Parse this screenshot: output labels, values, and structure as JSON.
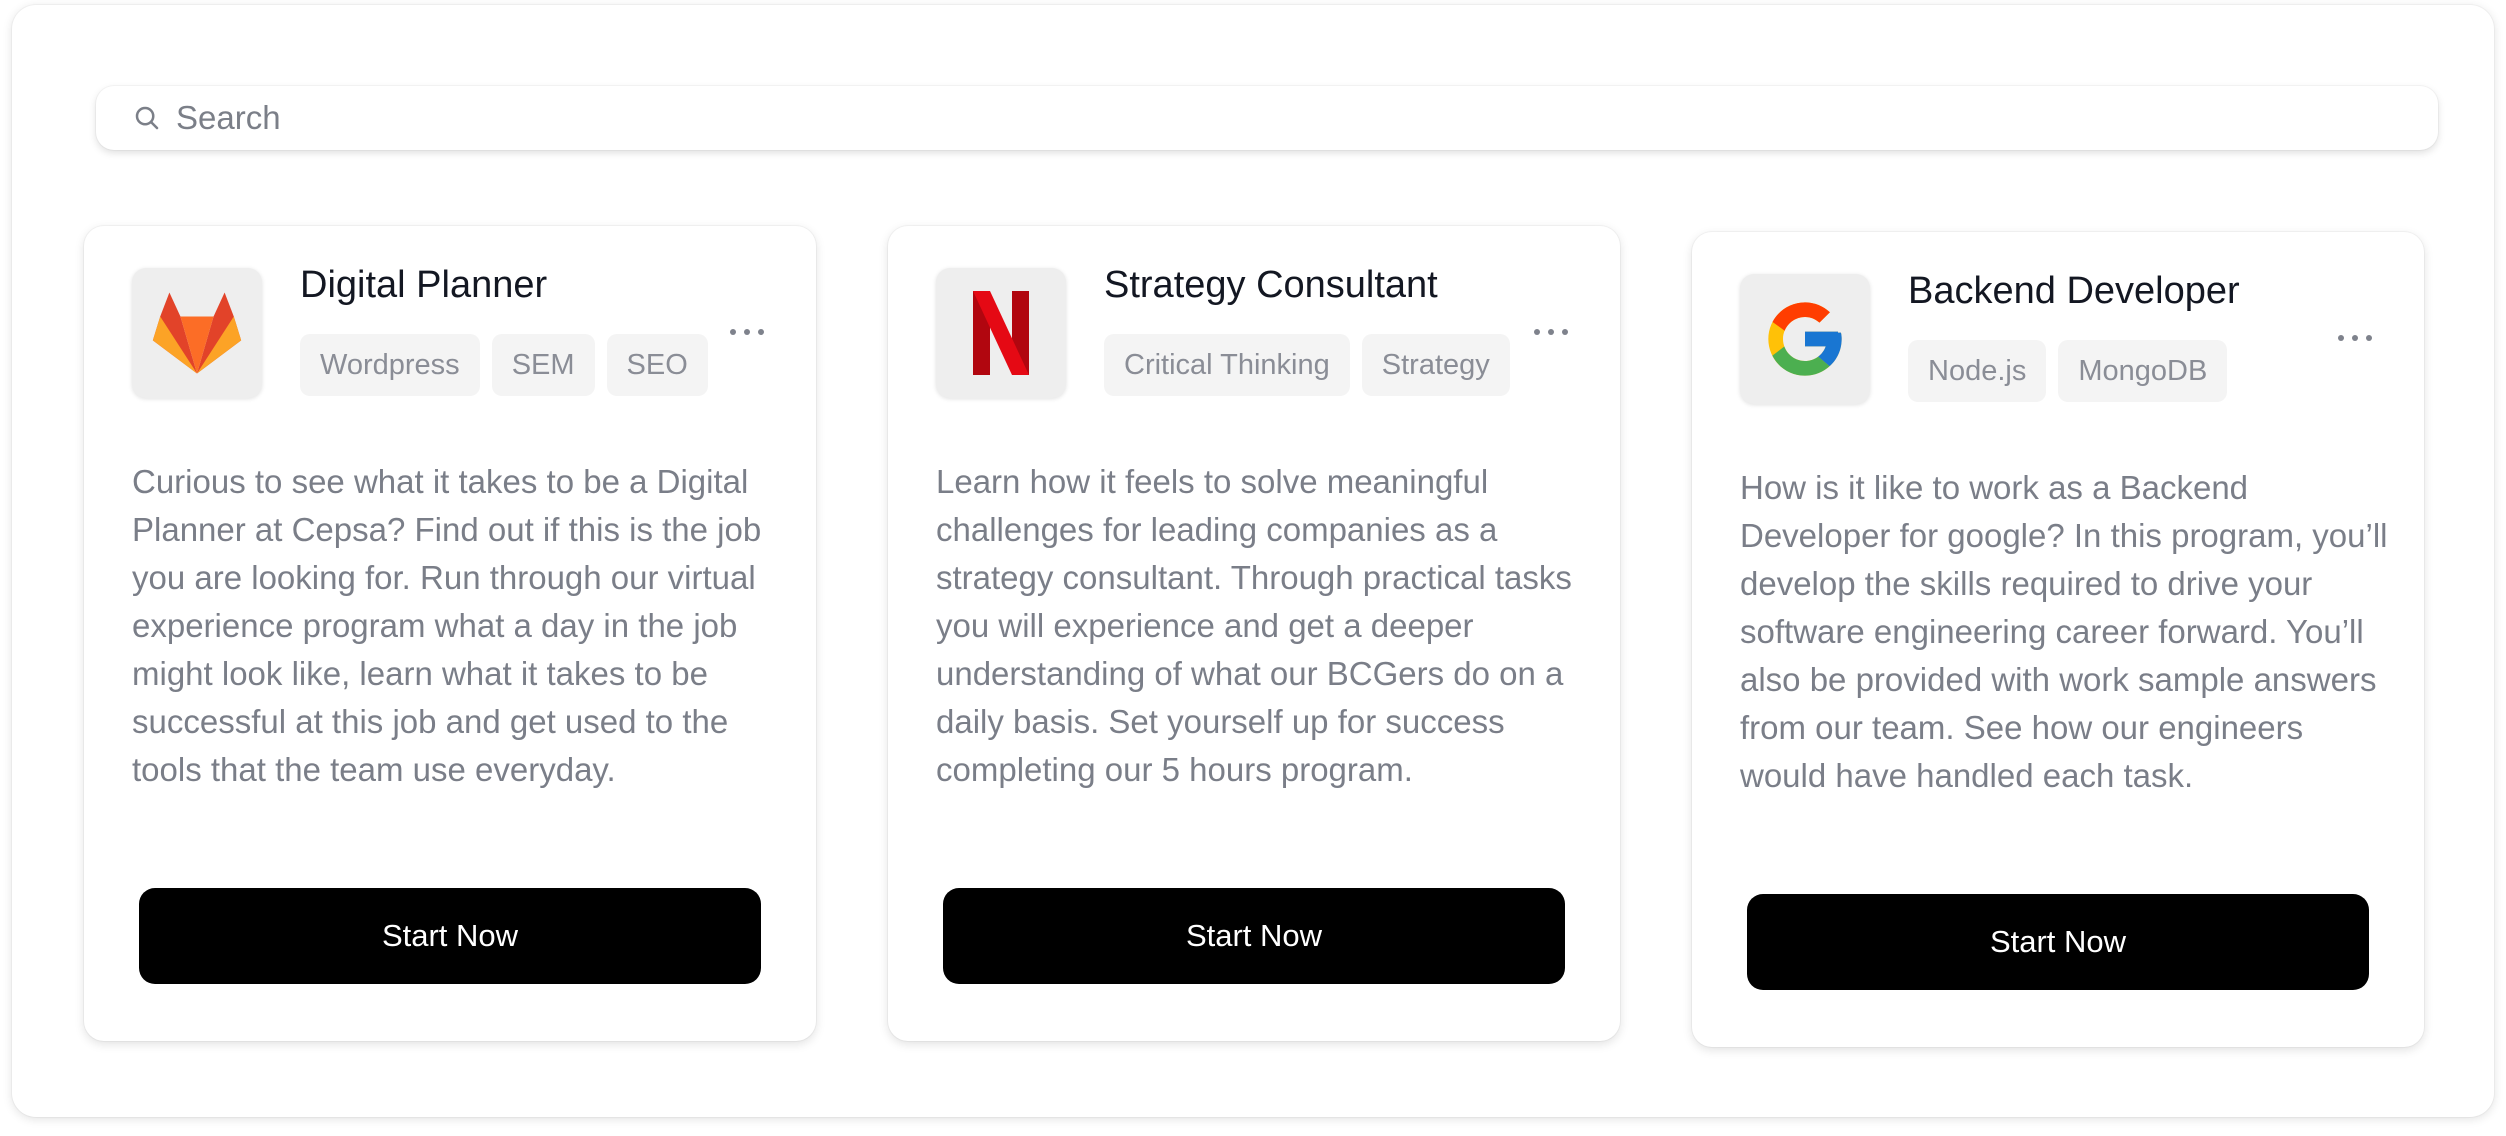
{
  "search": {
    "placeholder": "Search"
  },
  "cards": [
    {
      "logo": "gitlab-fox-logo",
      "title": "Digital Planner",
      "tags": [
        "Wordpress",
        "SEM",
        "SEO"
      ],
      "description": "Curious to see what it takes to be a Digital Planner at Cepsa? Find out if this is the job you are looking for. Run through our virtual experience program what a day in the job might look like, learn what it takes to be successful at this job and get used to the tools that the team use everyday.",
      "button_label": "Start Now"
    },
    {
      "logo": "netflix-n-logo",
      "title": "Strategy Consultant",
      "tags": [
        "Critical Thinking",
        "Strategy"
      ],
      "description": "Learn how it feels to solve meaningful challenges for leading companies as a strategy consultant. Through practical tasks you will experience and get a deeper understanding of what our BCGers do on a daily basis. Set yourself up for success completing our 5 hours program.",
      "button_label": "Start Now"
    },
    {
      "logo": "google-g-logo",
      "title": "Backend Developer",
      "tags": [
        "Node.js",
        "MongoDB"
      ],
      "description": "How is it like to work as a Backend Developer for google? In this program, you’ll develop the skills required to drive your software engineering career forward. You’ll also be provided with work sample answers from our team. See how our engineers would have handled each task.",
      "button_label": "Start Now"
    }
  ],
  "colors": {
    "button_bg": "#000000",
    "title_text": "#131722",
    "body_text": "#7a7e88",
    "tag_bg": "#f4f4f4"
  }
}
